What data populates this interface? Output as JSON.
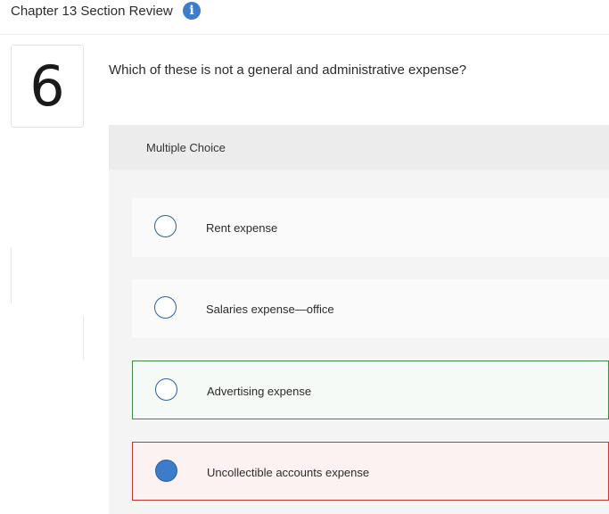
{
  "header": {
    "title": "Chapter 13 Section Review",
    "info_icon": "i"
  },
  "question": {
    "number": "6",
    "text": "Which of these is not a general and administrative expense?"
  },
  "answer_panel": {
    "type_label": "Multiple Choice",
    "choices": [
      {
        "label": "Rent expense",
        "selected": false,
        "state": "neutral"
      },
      {
        "label": "Salaries expense—office",
        "selected": false,
        "state": "neutral"
      },
      {
        "label": "Advertising expense",
        "selected": false,
        "state": "correct"
      },
      {
        "label": "Uncollectible accounts expense",
        "selected": true,
        "state": "incorrect"
      }
    ]
  },
  "colors": {
    "accent": "#3d7cc9",
    "correct_border": "#3f8b3f",
    "incorrect_border": "#c0392b"
  }
}
